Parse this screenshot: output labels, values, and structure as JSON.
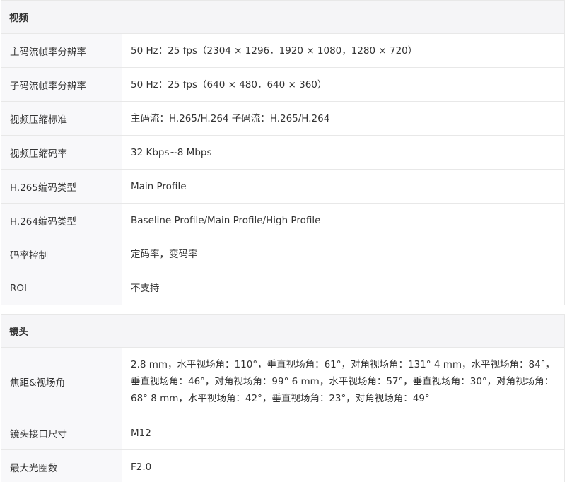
{
  "sections": [
    {
      "title": "视频",
      "rows": [
        {
          "label": "主码流帧率分辨率",
          "value": "50 Hz：25 fps（2304 × 1296，1920 × 1080，1280 × 720）"
        },
        {
          "label": "子码流帧率分辨率",
          "value": "50 Hz：25 fps（640 × 480，640 × 360）"
        },
        {
          "label": "视频压缩标准",
          "value": "主码流：H.265/H.264 子码流：H.265/H.264"
        },
        {
          "label": "视频压缩码率",
          "value": "32 Kbps~8 Mbps"
        },
        {
          "label": "H.265编码类型",
          "value": "Main Profile"
        },
        {
          "label": "H.264编码类型",
          "value": "Baseline Profile/Main Profile/High Profile"
        },
        {
          "label": "码率控制",
          "value": "定码率，变码率"
        },
        {
          "label": "ROI",
          "value": "不支持"
        }
      ]
    },
    {
      "title": "镜头",
      "rows": [
        {
          "label": "焦距&视场角",
          "value": "2.8 mm，水平视场角：110°，垂直视场角：61°，对角视场角：131° 4 mm，水平视场角：84°，垂直视场角：46°，对角视场角：99° 6 mm，水平视场角：57°，垂直视场角：30°，对角视场角：68° 8 mm，水平视场角：42°，垂直视场角：23°，对角视场角：49°"
        },
        {
          "label": "镜头接口尺寸",
          "value": "M12"
        },
        {
          "label": "最大光圈数",
          "value": "F2.0"
        }
      ]
    }
  ]
}
